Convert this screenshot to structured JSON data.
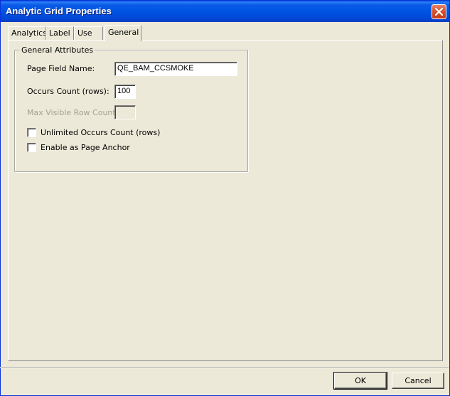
{
  "window": {
    "title": "Analytic Grid Properties"
  },
  "tabs": [
    {
      "label": "Analytics",
      "active": false
    },
    {
      "label": "Label",
      "active": false
    },
    {
      "label": "Use",
      "active": false
    },
    {
      "label": "General",
      "active": true
    }
  ],
  "general": {
    "group_title": "General Attributes",
    "page_field_name_label": "Page Field Name:",
    "page_field_name_value": "QE_BAM_CCSMOKE",
    "occurs_count_label": "Occurs Count (rows):",
    "occurs_count_value": "100",
    "max_visible_label": "Max Visible Row Count:",
    "max_visible_value": "",
    "unlimited_label": "Unlimited Occurs Count (rows)",
    "unlimited_checked": false,
    "anchor_label": "Enable as Page Anchor",
    "anchor_checked": false
  },
  "buttons": {
    "ok_label": "OK",
    "cancel_label": "Cancel"
  },
  "icons": {
    "close": "close-icon"
  }
}
